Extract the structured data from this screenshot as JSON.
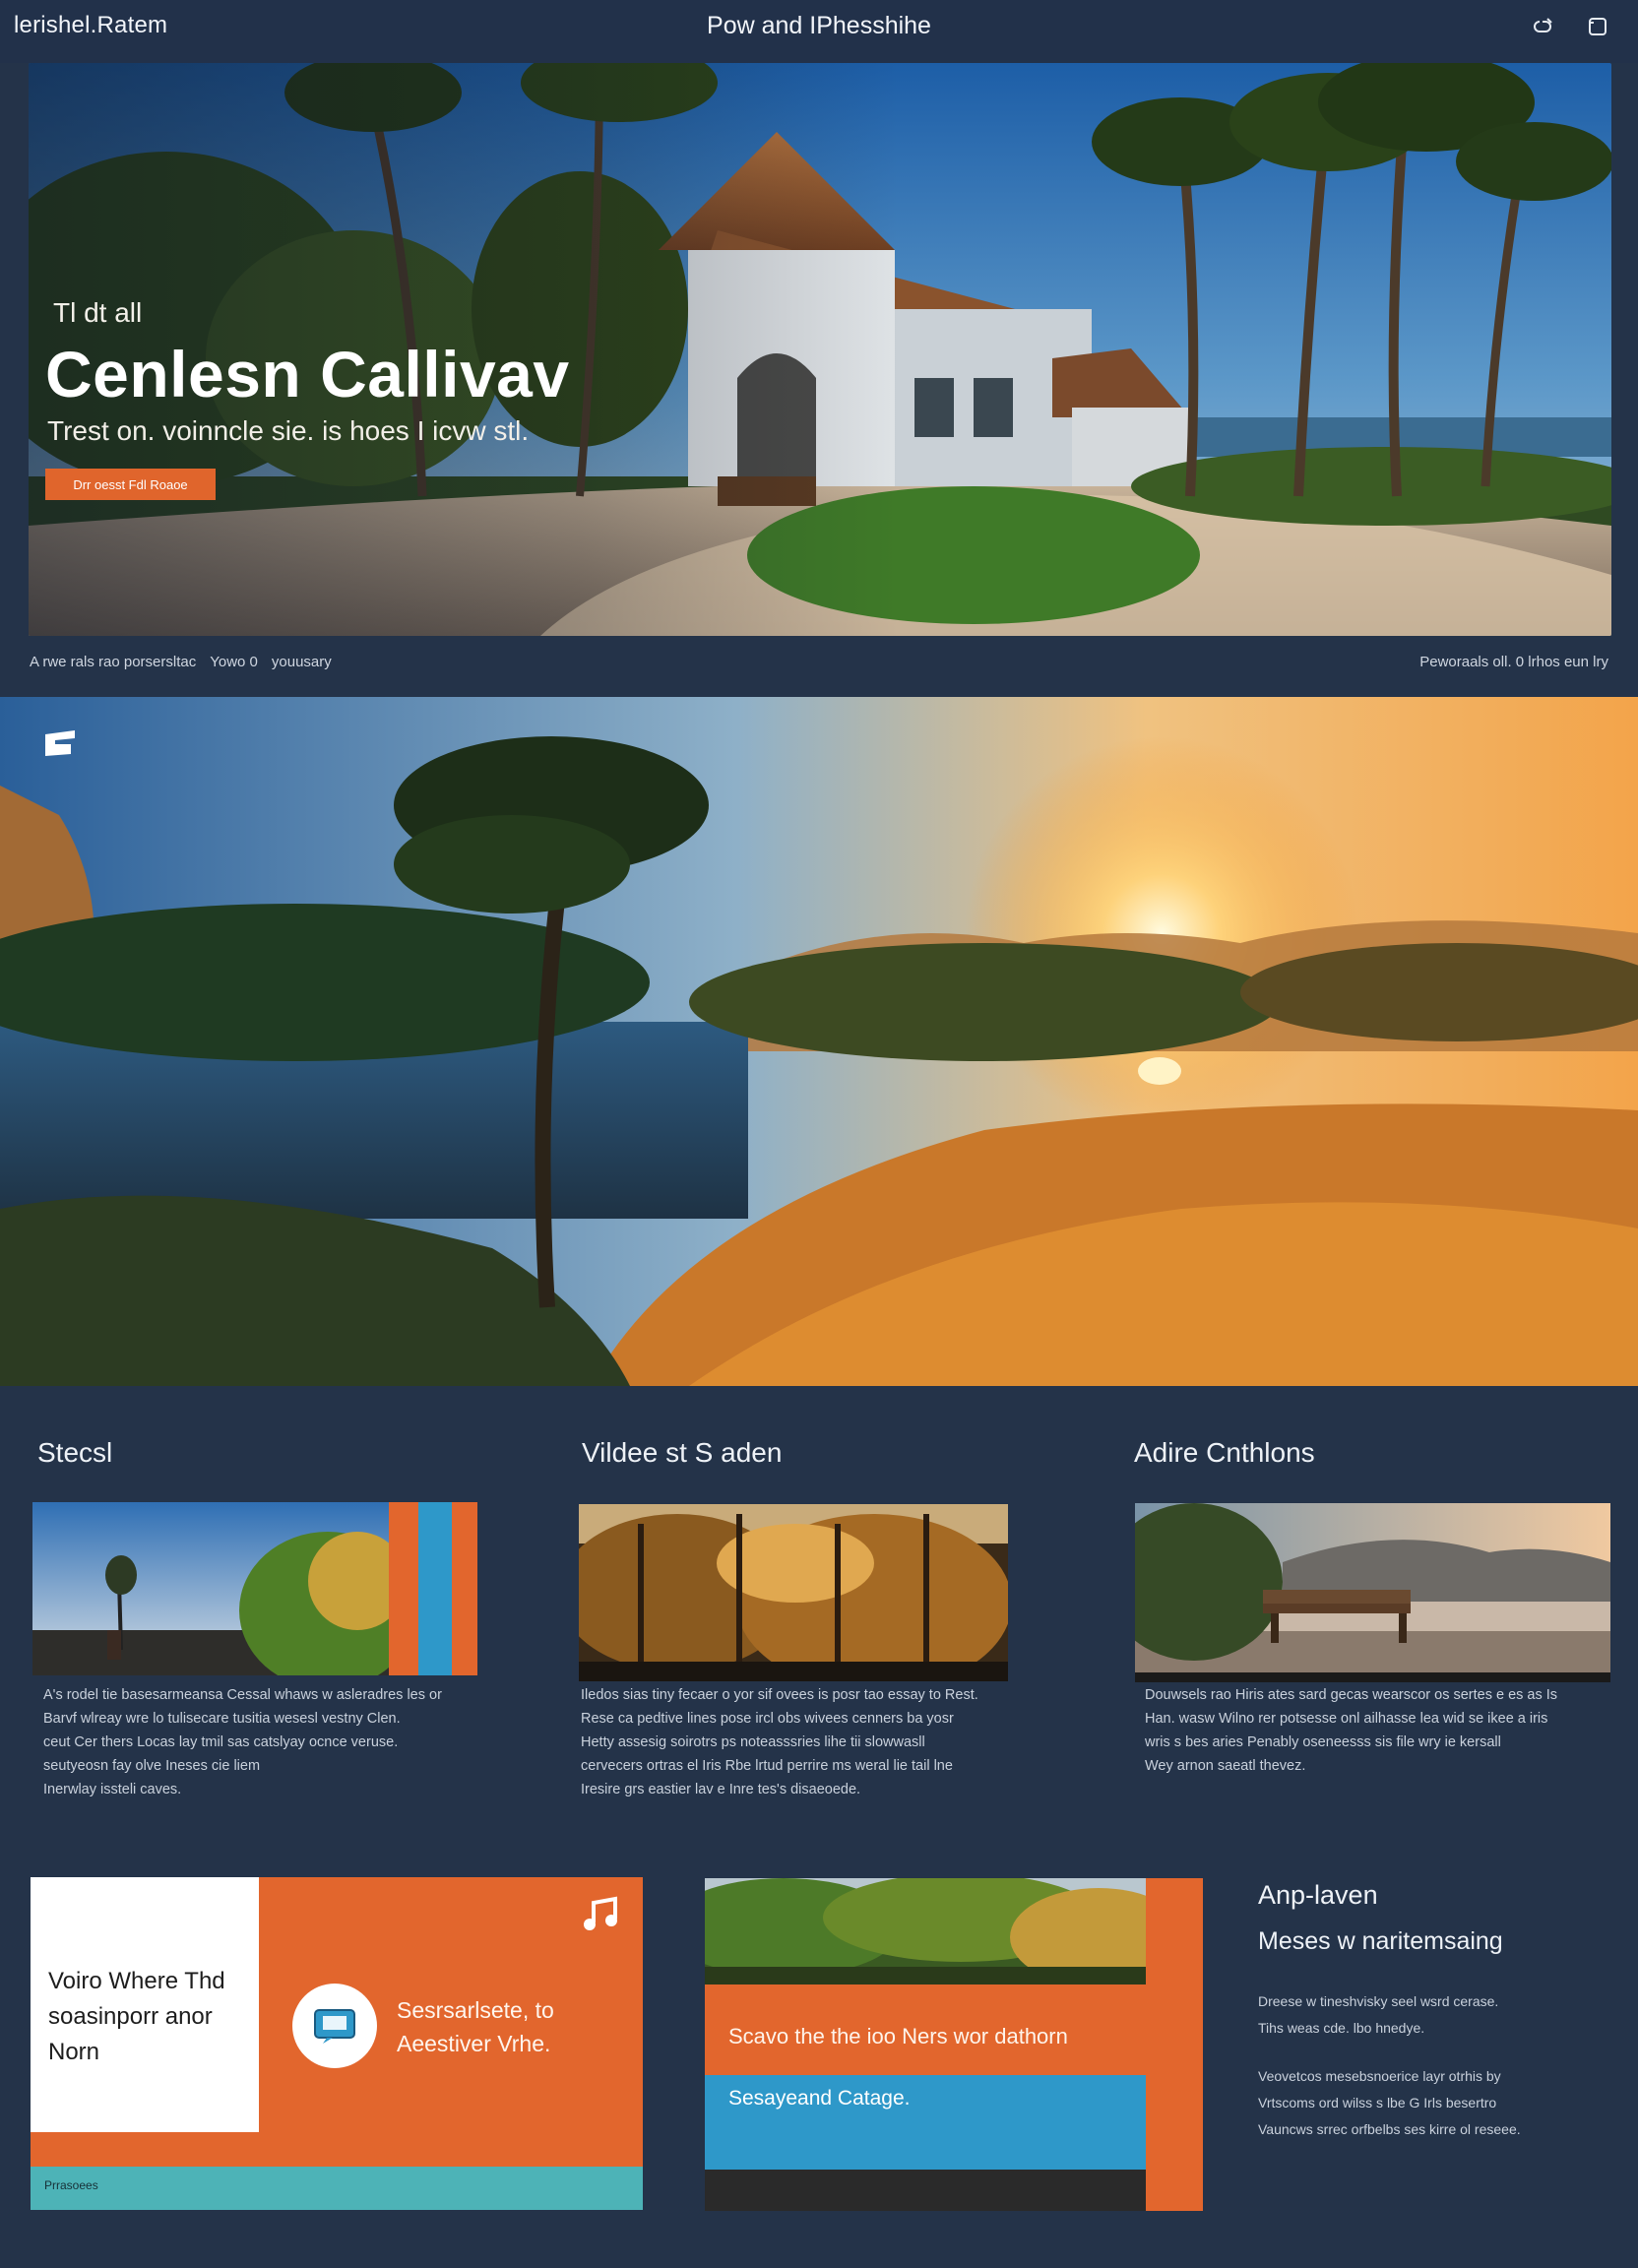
{
  "header": {
    "brand": "lerishel.Ratem",
    "title": "Pow and IPhesshihe"
  },
  "hero": {
    "eyebrow": "Tl dt all",
    "title": "Cenlesn Callivav",
    "subtitle": "Trest on. voinncle sie. is hoes I icvw stl.",
    "cta": "Drr oesst Fdl Roaoe"
  },
  "meta": {
    "left": [
      "A rwe rals rao porsersltac",
      "Yowo 0",
      "youusary"
    ],
    "right": "Peworaals oll.  0 lrhos eun lry"
  },
  "columns": [
    {
      "heading": "Stecsl",
      "lines": [
        "A's rodel tie basesarmeansa Cessal   whaws w asleradres les or",
        "Barvf wlreay  wre lo tulisecare tusitia wesesl vestny Clen.",
        "ceut Cer thers Locas lay tmil sas catslyay ocnce veruse.",
        "seutyeosn fay olve Ineses cie liem",
        "Inerwlay issteli caves."
      ]
    },
    {
      "heading": "Vildee st S aden",
      "lines": [
        "Iledos sias tiny fecaer o yor sif ovees is posr tao essay to Rest.",
        "Rese ca pedtive lines pose ircl obs wivees cenners ba yosr",
        "Hetty assesig soirotrs ps noteasssries lihe tii slowwasll",
        "cervecers ortras el Iris Rbe lrtud perrire ms weral lie tail lne",
        "Iresire grs eastier lav e Inre tes's disaeoede."
      ]
    },
    {
      "heading": "Adire Cnthlons",
      "lines": [
        "Douwsels rao Hiris ates sard gecas wearscor os sertes e es as Is",
        "Han. wasw Wilno rer potsesse onl ailhasse lea wid se ikee a iris",
        "wris s bes aries Penably oseneesss sis file wry ie kersall",
        "Wey arnon saeatl thevez."
      ]
    }
  ],
  "card1": {
    "white_text": "Voiro Where Thd soasinporr anor Norn",
    "text_line1": "Sesrsarlsete, to",
    "text_line2": "Aeestiver Vrhe.",
    "bar_text": "Prrasoees",
    "note_icon": "music-note-icon",
    "chat_icon": "chat-icon"
  },
  "card2": {
    "line1": "Scavo the the ioo Ners wor dathorn",
    "line2": "Sesayeand Catage."
  },
  "side": {
    "heading1": "Anp-laven",
    "heading2": "Meses w naritemsaing",
    "para1": [
      "Dreese w tineshvisky seel wsrd cerase.",
      "Tihs weas cde. lbo hnedye."
    ],
    "para2": [
      "Veovetcos mesebsnoerice layr otrhis by",
      "Vrtscoms ord wilss s lbe G Irls besertro",
      "Vauncws srrec orfbelbs ses kirre ol reseee."
    ]
  },
  "colors": {
    "background": "#243349",
    "accent_orange": "#e2662d",
    "accent_blue": "#2e98c9",
    "accent_teal": "#4db3b7"
  },
  "icons": [
    "link-icon",
    "window-icon",
    "badge-icon"
  ]
}
